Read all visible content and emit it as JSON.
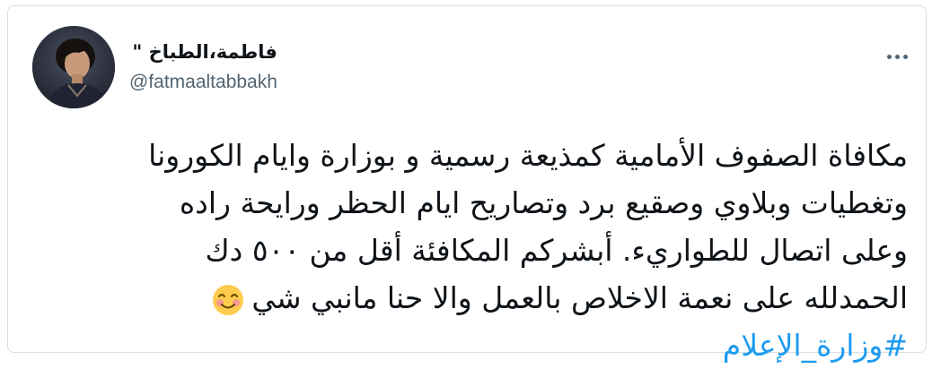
{
  "tweet": {
    "author": {
      "display_name": "فاطمة،الطباخ \"",
      "handle": "@fatmaaltabbakh",
      "avatar_icon": "profile-photo"
    },
    "more_icon": "more-options-icon",
    "lines": [
      "مكافاة الصفوف الأمامية كمذيعة رسمية و بوزارة وايام الكورونا",
      "وتغطيات وبلاوي وصقيع برد وتصاريح ايام الحظر ورايحة راده",
      "وعلى اتصال للطواريء. أبشركم المكافئة أقل من  ٥٠٠ دك",
      "الحمدلله على نعمة الاخلاص بالعمل والا حنا مانبي شي"
    ],
    "emoji": "smiling-face-with-smiling-eyes",
    "hashtag": "#وزارة_الإعلام",
    "colors": {
      "text": "#0f1419",
      "secondary": "#536471",
      "link": "#1d9bf0"
    }
  }
}
